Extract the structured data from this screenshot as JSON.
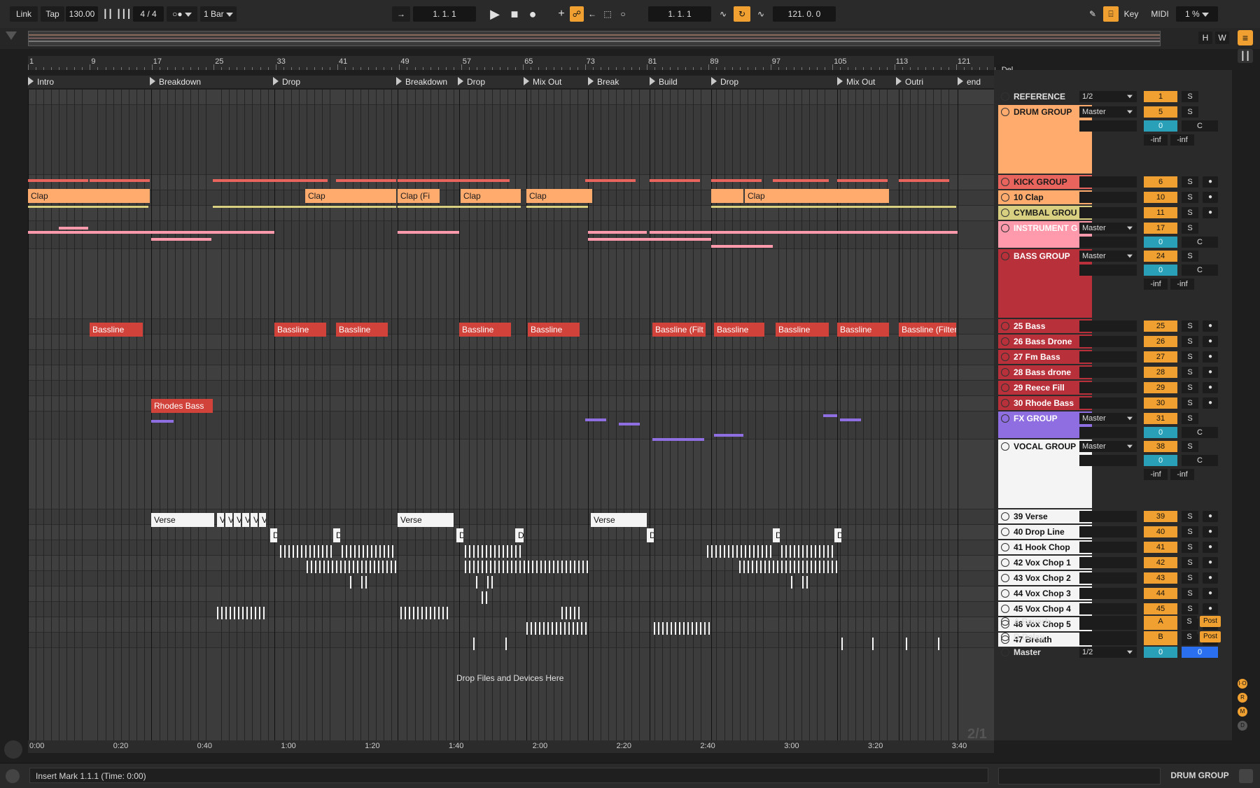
{
  "transport": {
    "link": "Link",
    "tap": "Tap",
    "tempo": "130.00",
    "signature": "4 / 4",
    "quantize": "1 Bar",
    "arrangement_position": "1.   1.   1",
    "loop_start": "1.   1.   1",
    "loop_length": "121.   0.   0",
    "key": "Key",
    "midi": "MIDI",
    "cpu": "1 %"
  },
  "overview": {
    "h_label": "H",
    "w_label": "W"
  },
  "ruler_bars": [
    "1",
    "9",
    "17",
    "25",
    "33",
    "41",
    "49",
    "57",
    "65",
    "73",
    "81",
    "89",
    "97",
    "105",
    "113",
    "121"
  ],
  "locators": [
    "Intro",
    "Breakdown",
    "Drop",
    "Breakdown",
    "Drop",
    "Mix Out",
    "Break",
    "Build",
    "Drop",
    "Mix Out",
    "Outri",
    "end"
  ],
  "del_label": "Del",
  "clips": {
    "clap": "Clap",
    "clap_filtered": "Clap (Fi",
    "bassline": "Bassline",
    "bassline_filter_1": "Bassline (Filt",
    "bassline_filter_2": "Bassline (Filter",
    "rhodes": "Rhodes Bass",
    "verse": "Verse",
    "drop_short": "D",
    "vox_v": "V"
  },
  "drop_hint": "Drop Files and Devices Here",
  "loop_indicator": "2/1",
  "tracks": [
    {
      "name": "REFERENCE",
      "number": "1",
      "route": "1/2",
      "color": "#2a2a2a",
      "text": "#e0e0e0"
    },
    {
      "name": "DRUM GROUP",
      "number": "5",
      "route": "Master",
      "pan": "0",
      "pan_c": "C",
      "inf_l": "-inf",
      "inf_r": "-inf",
      "color": "#ffab6e",
      "text": "#1a1a1a"
    },
    {
      "name": "KICK GROUP",
      "number": "6",
      "color": "#e8645c",
      "text": "#1a1a1a"
    },
    {
      "name": "10 Clap",
      "number": "10",
      "color": "#ffab6e",
      "text": "#1a1a1a"
    },
    {
      "name": "CYMBAL GROU",
      "number": "11",
      "color": "#d8d080",
      "text": "#1a1a1a"
    },
    {
      "name": "INSTRUMENT G",
      "number": "17",
      "route": "Master",
      "pan": "0",
      "pan_c": "C",
      "color": "#ff9aac",
      "text": "#ffffff"
    },
    {
      "name": "BASS GROUP",
      "number": "24",
      "route": "Master",
      "pan": "0",
      "pan_c": "C",
      "inf_l": "-inf",
      "inf_r": "-inf",
      "color": "#b8303a",
      "text": "#ffffff"
    },
    {
      "name": "25 Bass",
      "number": "25",
      "color": "#b8303a",
      "text": "#ffffff"
    },
    {
      "name": "26 Bass Drone",
      "number": "26",
      "color": "#b8303a",
      "text": "#ffffff"
    },
    {
      "name": "27 Fm Bass",
      "number": "27",
      "color": "#b8303a",
      "text": "#ffffff"
    },
    {
      "name": "28 Bass drone",
      "number": "28",
      "color": "#b8303a",
      "text": "#ffffff"
    },
    {
      "name": "29 Reece Fill",
      "number": "29",
      "color": "#b8303a",
      "text": "#ffffff"
    },
    {
      "name": "30 Rhode Bass",
      "number": "30",
      "color": "#b8303a",
      "text": "#ffffff"
    },
    {
      "name": "FX GROUP",
      "number": "31",
      "route": "Master",
      "pan": "0",
      "pan_c": "C",
      "color": "#8e6ee0",
      "text": "#ffffff"
    },
    {
      "name": "VOCAL GROUP",
      "number": "38",
      "route": "Master",
      "pan": "0",
      "pan_c": "C",
      "inf_l": "-inf",
      "inf_r": "-inf",
      "color": "#f4f4f4",
      "text": "#111111"
    },
    {
      "name": "39 Verse",
      "number": "39",
      "color": "#f4f4f4",
      "text": "#111111"
    },
    {
      "name": "40 Drop Line",
      "number": "40",
      "color": "#f4f4f4",
      "text": "#111111"
    },
    {
      "name": "41 Hook Chop",
      "number": "41",
      "color": "#f4f4f4",
      "text": "#111111"
    },
    {
      "name": "42 Vox Chop 1",
      "number": "42",
      "color": "#f4f4f4",
      "text": "#111111"
    },
    {
      "name": "43 Vox Chop 2",
      "number": "43",
      "color": "#f4f4f4",
      "text": "#111111"
    },
    {
      "name": "44 Vox Chop 3",
      "number": "44",
      "color": "#f4f4f4",
      "text": "#111111"
    },
    {
      "name": "45 Vox Chop 4",
      "number": "45",
      "color": "#f4f4f4",
      "text": "#111111"
    },
    {
      "name": "46 Vox Chop 5",
      "number": "46",
      "color": "#f4f4f4",
      "text": "#111111"
    },
    {
      "name": "47 Breath",
      "number": "47",
      "color": "#f4f4f4",
      "text": "#111111"
    }
  ],
  "returns": [
    {
      "name": "A Reverb",
      "number": "A",
      "post": "Post"
    },
    {
      "name": "B Delay",
      "number": "B",
      "post": "Post"
    },
    {
      "name": "Master",
      "number": "0",
      "route": "1/2",
      "number2": "0"
    }
  ],
  "solo_label": "S",
  "time_labels": [
    "0:00",
    "0:20",
    "0:40",
    "1:00",
    "1:20",
    "1:40",
    "2:00",
    "2:20",
    "2:40",
    "3:00",
    "3:20",
    "3:40"
  ],
  "status_text": "Insert Mark 1.1.1 (Time: 0:00)",
  "status_track": "DRUM GROUP",
  "right_badges": [
    "I·O",
    "R",
    "M",
    "D"
  ]
}
